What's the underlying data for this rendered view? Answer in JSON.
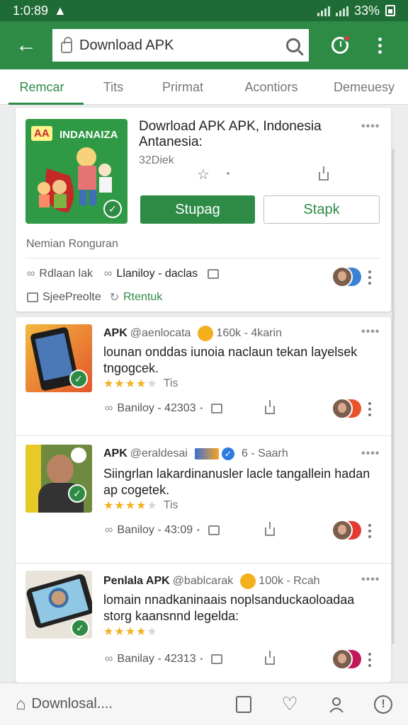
{
  "status": {
    "time": "1:0:89",
    "battery": "33%"
  },
  "search": {
    "value": "Download APK"
  },
  "tabs": [
    "Remcar",
    "Tits",
    "Prirmat",
    "Acontiors",
    "Demeuesy"
  ],
  "featured": {
    "art_badge": "AA",
    "art_label": "INDANAIZA",
    "title": "Dowrload APK APK, Indonesia",
    "subtitle": "Antanesia:",
    "count": "32Diek",
    "primary_button": "Stupag",
    "secondary_button": "Stapk",
    "meta": "Nemian Ronguran",
    "row1_a": "Rdlaan lak",
    "row1_b": "Llaniloy - daclas",
    "row2_a": "SjeePreolte",
    "row2_b": "Rtentuk"
  },
  "posts": [
    {
      "brand": "APK",
      "handle": "@aenlocata",
      "stats": "160k - 4karin",
      "line1": "lounan onddas iunoia naclaun tekan layelsek",
      "line2": "tngogcek.",
      "rating": 4,
      "rating_label": "Tis",
      "meta": "Baniloy - 42303"
    },
    {
      "brand": "APK",
      "handle": "@eraldesai",
      "stats": "6 - Saarh",
      "line1": "Siingrlan lakardinanusler lacle tangallein hadan",
      "line2": "ap cogetek.",
      "rating": 4,
      "rating_label": "Tis",
      "meta": "Baniloy - 43:09"
    },
    {
      "brand": "Penlala APK",
      "handle": "@bablcarak",
      "stats": "100k - Rcah",
      "line1": "lomain nnadkaninaais noplsanduckaoloadaa",
      "line2": "storg kaansnnd legelda:",
      "rating": 4,
      "rating_label": "",
      "meta": "Banilay - 42313"
    }
  ],
  "bottom_nav": {
    "label": "Downlosal...."
  },
  "colors": {
    "primary": "#2e8b46",
    "status_bar": "#1f6b36",
    "star": "#f2b01e"
  }
}
